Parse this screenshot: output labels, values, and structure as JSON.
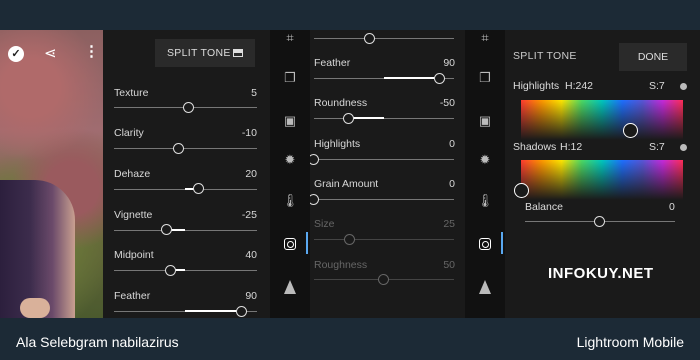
{
  "panel_left": {
    "photo_icons": {
      "check": "check-icon",
      "share": "share-icon",
      "more": "more-icon"
    },
    "split_tone_button": "SPLIT TONE",
    "sliders": [
      {
        "label": "Texture",
        "value": "5"
      },
      {
        "label": "Clarity",
        "value": "-10"
      },
      {
        "label": "Dehaze",
        "value": "20"
      },
      {
        "label": "Vignette",
        "value": "-25"
      },
      {
        "label": "Midpoint",
        "value": "40"
      },
      {
        "label": "Feather",
        "value": "90"
      }
    ]
  },
  "panel_middle": {
    "sliders": [
      {
        "label": "Feather",
        "value": "90",
        "enabled": true
      },
      {
        "label": "Roundness",
        "value": "-50",
        "enabled": true
      },
      {
        "label": "Highlights",
        "value": "0",
        "enabled": true
      },
      {
        "label": "Grain Amount",
        "value": "0",
        "enabled": true
      },
      {
        "label": "Size",
        "value": "25",
        "enabled": false
      },
      {
        "label": "Roughness",
        "value": "50",
        "enabled": false
      }
    ]
  },
  "rail_icons": [
    "crop-icon",
    "presets-icon",
    "photo-adjust-icon",
    "light-icon",
    "temperature-icon",
    "vignette-effects-icon",
    "triangle-icon"
  ],
  "panel_right": {
    "title": "SPLIT TONE",
    "done": "DONE",
    "highlights": {
      "label": "Highlights",
      "hue": "H:242",
      "sat": "S:7"
    },
    "shadows": {
      "label": "Shadows",
      "hue": "H:12",
      "sat": "S:7"
    },
    "balance": {
      "label": "Balance",
      "value": "0"
    }
  },
  "watermark": "INFOKUY.NET",
  "caption_left": "Ala Selebgram nabilazirus",
  "caption_right": "Lightroom Mobile",
  "colors": {
    "accent": "#5aa8f0",
    "background": "#1c2a36",
    "panel": "#1a1a1a"
  }
}
